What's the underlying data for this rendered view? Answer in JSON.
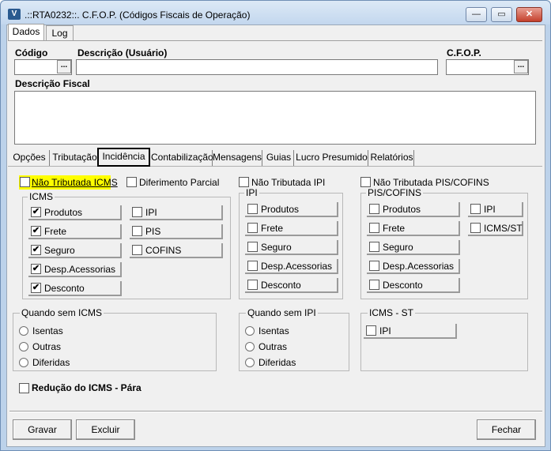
{
  "window": {
    "title": ".::RTA0232::. C.F.O.P. (Códigos Fiscais de Operação)",
    "icon": "app-logo-icon",
    "minimize": "—",
    "maximize": "▭",
    "close": "✕"
  },
  "top_tabs": [
    "Dados",
    "Log"
  ],
  "fields": {
    "codigo_label": "Código",
    "descricao_label": "Descrição (Usuário)",
    "cfop_label": "C.F.O.P.",
    "descricao_fiscal_label": "Descrição Fiscal",
    "ellipsis": "..."
  },
  "sub_tabs": [
    "Opções",
    "Tributação",
    "Incidência",
    "Contabilização",
    "Mensagens",
    "Guias",
    "Lucro Presumido",
    "Relatórios"
  ],
  "incidencia": {
    "nao_tributada_icms": "Não Tributada ICMS",
    "diferimento_parcial": "Diferimento Parcial",
    "nao_tributada_ipi": "Não Tributada IPI",
    "nao_tributada_pis_cofins": "Não Tributada PIS/COFINS",
    "icms_group": {
      "title": "ICMS",
      "left": [
        {
          "label": "Produtos",
          "checked": "✔"
        },
        {
          "label": "Frete",
          "checked": "✔"
        },
        {
          "label": "Seguro",
          "checked": "✔"
        },
        {
          "label": "Desp.Acessorias",
          "checked": "✔"
        },
        {
          "label": "Desconto",
          "checked": "✔"
        }
      ],
      "right": [
        "IPI",
        "PIS",
        "COFINS"
      ]
    },
    "ipi_group": {
      "title": "IPI",
      "items": [
        "Produtos",
        "Frete",
        "Seguro",
        "Desp.Acessorias",
        "Desconto"
      ]
    },
    "pis_group": {
      "title": "PIS/COFINS",
      "left": [
        "Produtos",
        "Frete",
        "Seguro",
        "Desp.Acessorias",
        "Desconto"
      ],
      "right": [
        "IPI",
        "ICMS/ST"
      ]
    },
    "quando_sem_icms": {
      "title": "Quando sem ICMS",
      "options": [
        "Isentas",
        "Outras",
        "Diferidas"
      ]
    },
    "quando_sem_ipi": {
      "title": "Quando sem IPI",
      "options": [
        "Isentas",
        "Outras",
        "Diferidas"
      ]
    },
    "icms_st": {
      "title": "ICMS - ST",
      "items": [
        "IPI"
      ]
    },
    "reducao": "Redução do ICMS - Pára"
  },
  "buttons": {
    "gravar": "Gravar",
    "excluir": "Excluir",
    "fechar": "Fechar"
  }
}
